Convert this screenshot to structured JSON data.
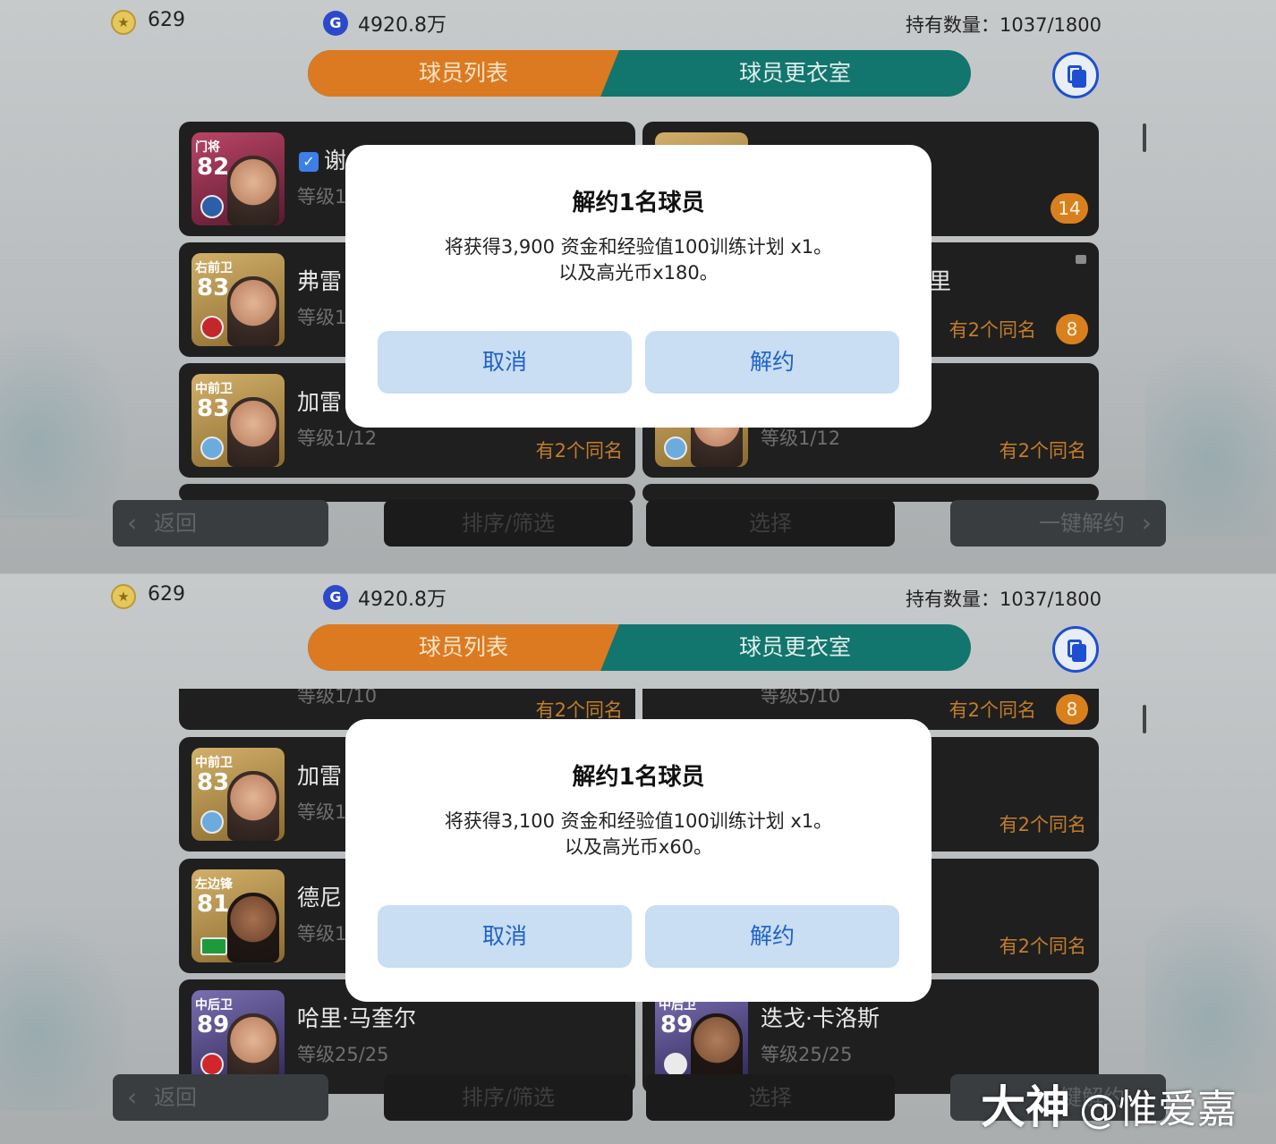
{
  "currency": {
    "coins": "629",
    "gp": "4920.8万",
    "holding": "持有数量：1037/1800",
    "coin_icon": "star-coin-icon",
    "gp_icon": "G"
  },
  "tabs": {
    "player_list": "球员列表",
    "locker_room": "球员更衣室"
  },
  "bottom": {
    "back": "返回",
    "sort": "排序/筛选",
    "select": "选择",
    "release_all": "一键解约"
  },
  "panel1": {
    "cards": [
      {
        "pos": "门将",
        "rating": "82",
        "name": "谢",
        "level": "等级1",
        "checked": true
      },
      {
        "badge": "14"
      },
      {
        "pos": "右前卫",
        "rating": "83",
        "name": "弗雷",
        "level": "等级1"
      },
      {
        "name": "里",
        "dupe": "有2个同名",
        "badge": "8"
      },
      {
        "pos": "中前卫",
        "rating": "83",
        "name": "加雷",
        "level": "等级1/12",
        "dupe": "有2个同名"
      },
      {
        "level": "等级1/12",
        "dupe": "有2个同名"
      }
    ],
    "modal": {
      "title": "解约1名球员",
      "line1": "将获得3,900 资金和经验值100训练计划 x1。",
      "line2": "以及高光币x180。",
      "cancel": "取消",
      "confirm": "解约"
    }
  },
  "panel2": {
    "top_row": {
      "left_level": "等级1/10",
      "left_dupe": "有2个同名",
      "right_level": "等级5/10",
      "right_dupe": "有2个同名",
      "right_badge": "8"
    },
    "cards": [
      {
        "pos": "中前卫",
        "rating": "83",
        "name": "加雷",
        "level": "等级1"
      },
      {
        "dupe": "有2个同名"
      },
      {
        "pos": "左边锋",
        "rating": "81",
        "name": "德尼",
        "level": "等级1"
      },
      {
        "dupe": "有2个同名"
      },
      {
        "pos": "中后卫",
        "rating": "89",
        "name": "哈里·马奎尔",
        "level": "等级25/25"
      },
      {
        "pos": "中后卫",
        "rating": "89",
        "name": "迭戈·卡洛斯",
        "level": "等级25/25"
      }
    ],
    "modal": {
      "title": "解约1名球员",
      "line1": "将获得3,100 资金和经验值100训练计划 x1。",
      "line2": "以及高光币x60。",
      "cancel": "取消",
      "confirm": "解约"
    }
  },
  "watermark": {
    "brand": "大神",
    "handle": "@惟爱嘉"
  }
}
